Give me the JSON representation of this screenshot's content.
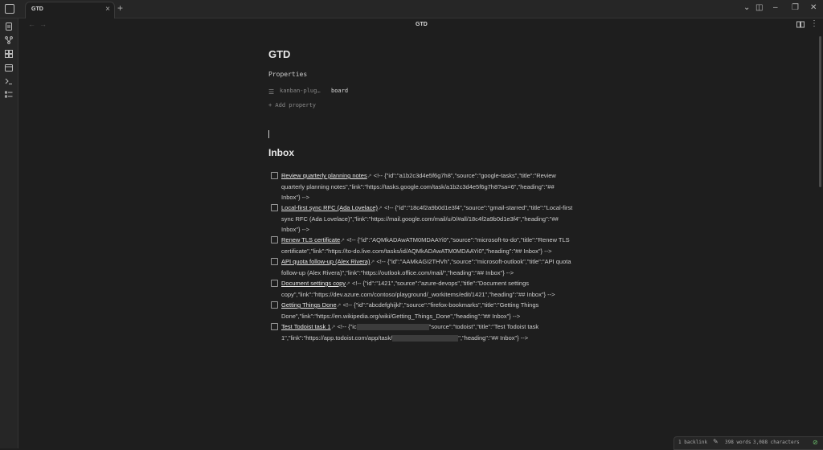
{
  "tab": {
    "label": "GTD",
    "close_glyph": "×",
    "new_tab_glyph": "+"
  },
  "window_controls": [
    "⌄",
    "◫",
    "–",
    "❐",
    "✕"
  ],
  "nav": {
    "back": "←",
    "forward": "→",
    "view_title": "GTD",
    "more": "⋮"
  },
  "note": {
    "title": "GTD",
    "properties_heading": "Properties",
    "property": {
      "key": "kanban-plug…",
      "value": "board"
    },
    "add_property": "+ Add property",
    "section_heading": "Inbox"
  },
  "tasks": [
    {
      "title": "Review quarterly planning notes",
      "rest": " <!-- {\"id\":\"a1b2c3d4e5f6g7h8\",\"source\":\"google-tasks\",\"title\":\"Review quarterly planning notes\",\"link\":\"https://tasks.google.com/task/a1b2c3d4e5f6g7h8?sa=6\",\"heading\":\"## Inbox\"} -->"
    },
    {
      "title": "Local-first sync RFC (Ada Lovelace)",
      "rest": " <!-- {\"id\":\"18c4f2a9b0d1e3f4\",\"source\":\"gmail-starred\",\"title\":\"Local-first sync RFC (Ada Lovelace)\",\"link\":\"https://mail.google.com/mail/u/0/#all/18c4f2a9b0d1e3f4\",\"heading\":\"## Inbox\"} -->"
    },
    {
      "title": "Renew TLS certificate",
      "rest": " <!-- {\"id\":\"AQMkADAwATM0MDAAYi0\",\"source\":\"microsoft-to-do\",\"title\":\"Renew TLS certificate\",\"link\":\"https://to-do.live.com/tasks/id/AQMkADAwATM0MDAAYi0\",\"heading\":\"## Inbox\"} -->"
    },
    {
      "title": "API quota follow-up (Alex Rivera)",
      "rest": " <!-- {\"id\":\"AAMkAGI2THVh\",\"source\":\"microsoft-outlook\",\"title\":\"API quota follow-up (Alex Rivera)\",\"link\":\"https://outlook.office.com/mail/\",\"heading\":\"## Inbox\"} -->"
    },
    {
      "title": "Document settings copy",
      "rest": " <!-- {\"id\":\"1421\",\"source\":\"azure-devops\",\"title\":\"Document settings copy\",\"link\":\"https://dev.azure.com/contoso/playground/_workitems/edit/1421\",\"heading\":\"## Inbox\"} -->"
    },
    {
      "title": "Getting Things Done",
      "rest": " <!-- {\"id\":\"abcdefghijkl\",\"source\":\"firefox-bookmarks\",\"title\":\"Getting Things Done\",\"link\":\"https://en.wikipedia.org/wiki/Getting_Things_Done\",\"heading\":\"## Inbox\"} -->"
    }
  ],
  "last_task": {
    "title": "Test Todoist task 1",
    "part1": " <!-- {\"ic",
    "part2": "\"source\":\"todoist\",\"title\":\"Test Todoist task 1\",\"link\":\"https://app.todoist.com/app/task/",
    "part3": "\",\"heading\":\"## Inbox\"} -->"
  },
  "status": {
    "backlinks": "1 backlink",
    "words": "398 words",
    "characters": "3,088 characters"
  }
}
